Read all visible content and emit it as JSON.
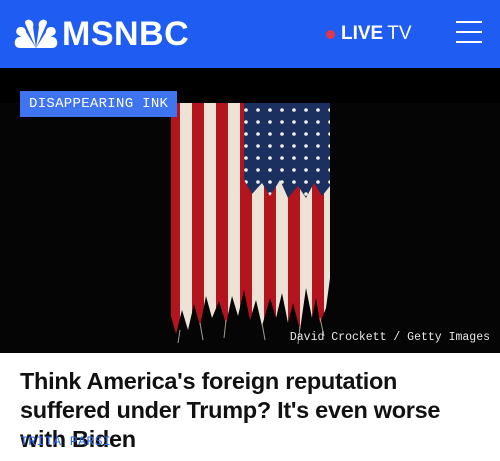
{
  "header": {
    "brand": "MSNBC",
    "live_label_bold": "LIVE",
    "live_label_thin": "TV",
    "brand_color": "#1f5cf2",
    "live_dot_color": "#e0384a",
    "menu_icon": "hamburger-menu-icon"
  },
  "article": {
    "section_tag": "DISAPPEARING INK",
    "image_credit": "David Crockett / Getty Images",
    "headline": "Think America's foreign reputation suffered under Trump? It's even worse with Biden",
    "author": "TRITA PARSI"
  }
}
